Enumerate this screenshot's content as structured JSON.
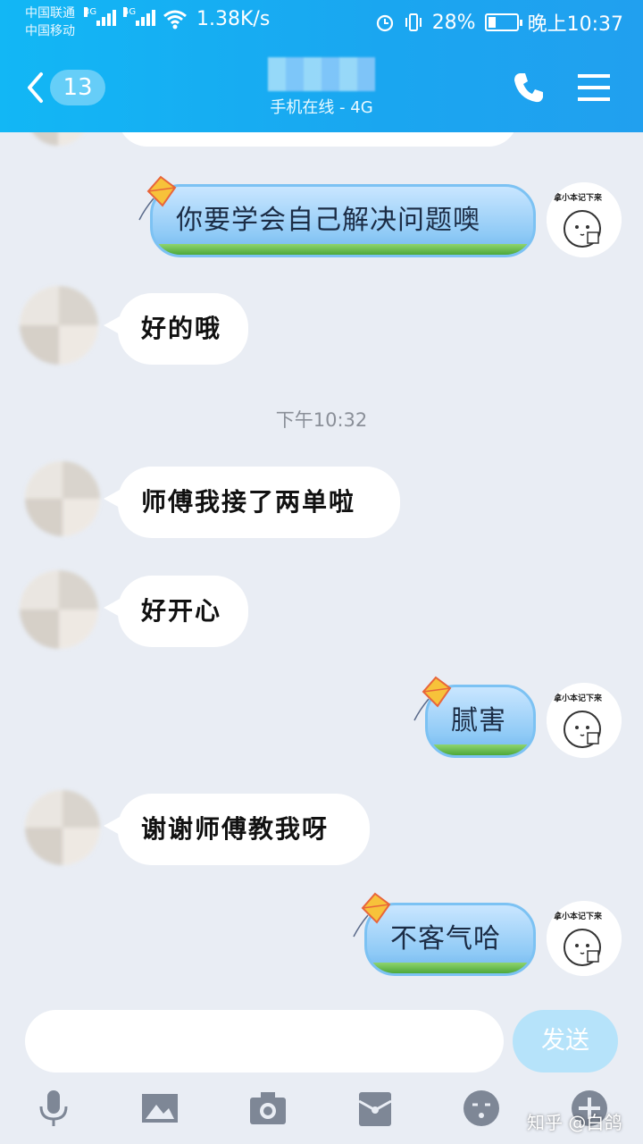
{
  "status_bar": {
    "carrier_1": "中国联通",
    "carrier_2": "中国移动",
    "net_1": "3G",
    "net_2": "4G",
    "speed": "1.38K/s",
    "battery": "28%",
    "battery_level": 0.28,
    "time": "晚上10:37"
  },
  "header": {
    "unread_count": "13",
    "contact_status": "手机在线 - 4G",
    "theme_color": "#12b7f5"
  },
  "messages": [
    {
      "from": "me",
      "text": "你要学会自己解决问题噢",
      "sticker_text": "拿小本记下来"
    },
    {
      "from": "them",
      "text": "好的哦"
    },
    {
      "type": "time",
      "text": "下午10:32"
    },
    {
      "from": "them",
      "text": "师傅我接了两单啦"
    },
    {
      "from": "them",
      "text": "好开心"
    },
    {
      "from": "me",
      "text": "腻害",
      "sticker_text": "拿小本记下来"
    },
    {
      "from": "them",
      "text": "谢谢师傅教我呀"
    },
    {
      "from": "me",
      "text": "不客气哈",
      "sticker_text": "拿小本记下来"
    }
  ],
  "input": {
    "placeholder": "",
    "send_label": "发送"
  },
  "toolbar": {
    "icons": [
      "microphone-icon",
      "image-icon",
      "camera-icon",
      "red-packet-icon",
      "emoji-icon",
      "plus-icon"
    ]
  },
  "watermark": "知乎 @白鸽"
}
